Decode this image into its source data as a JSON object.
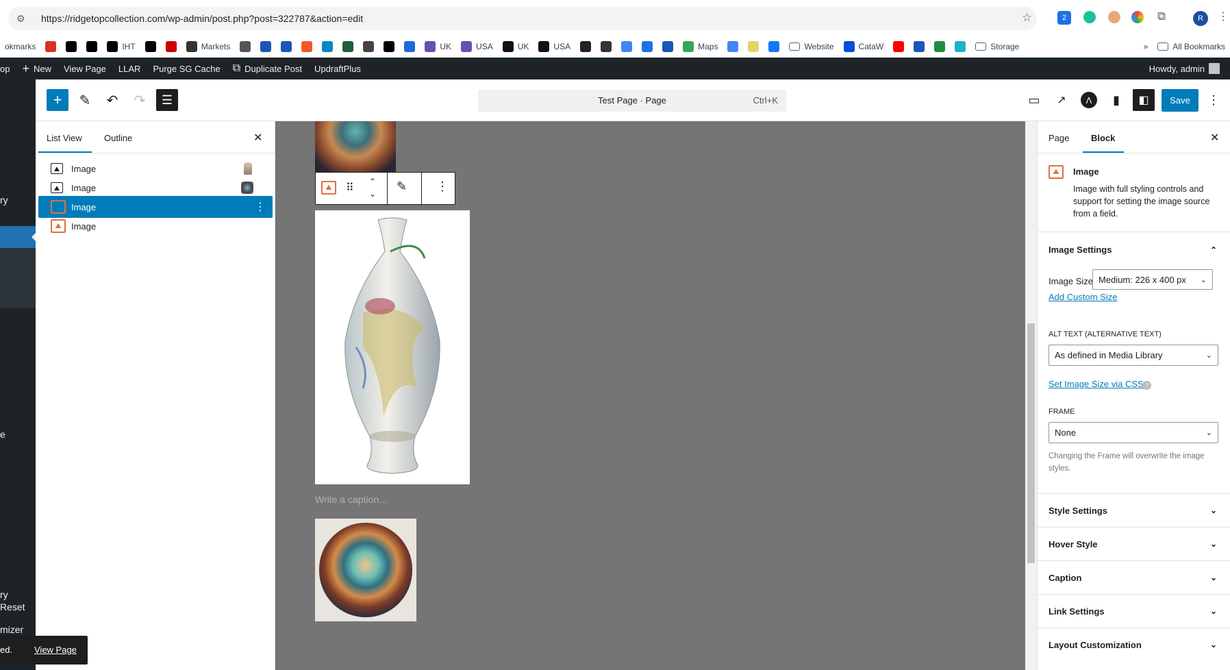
{
  "browser": {
    "url": "https://ridgetopcollection.com/wp-admin/post.php?post=322787&action=edit",
    "bookmarks": [
      {
        "label": "okmarks",
        "icon": "none"
      },
      {
        "label": "",
        "icon": "red-puzzle-icon"
      },
      {
        "label": "",
        "icon": "v-icon"
      },
      {
        "label": "",
        "icon": "t-icon"
      },
      {
        "label": "IHT",
        "icon": "nyt-icon"
      },
      {
        "label": "",
        "icon": "b-icon"
      },
      {
        "label": "",
        "icon": "cnn-icon"
      },
      {
        "label": "Markets",
        "icon": "markets-icon"
      },
      {
        "label": "",
        "icon": "globe-icon"
      },
      {
        "label": "",
        "icon": "b-blue-icon"
      },
      {
        "label": "",
        "icon": "shield-icon"
      },
      {
        "label": "",
        "icon": "orange-icon"
      },
      {
        "label": "",
        "icon": "arrow-icon"
      },
      {
        "label": "",
        "icon": "chart-icon"
      },
      {
        "label": "",
        "icon": "stripes-icon"
      },
      {
        "label": "",
        "icon": "b-circle-icon"
      },
      {
        "label": "",
        "icon": "sf-icon"
      },
      {
        "label": "UK",
        "icon": "bag-icon"
      },
      {
        "label": "USA",
        "icon": "bag-icon"
      },
      {
        "label": "UK",
        "icon": "amazon-icon"
      },
      {
        "label": "USA",
        "icon": "amazon-icon"
      },
      {
        "label": "",
        "icon": "w-question-icon"
      },
      {
        "label": "",
        "icon": "wikipedia-icon"
      },
      {
        "label": "",
        "icon": "google-icon"
      },
      {
        "label": "",
        "icon": "calendar-icon"
      },
      {
        "label": "",
        "icon": "person-icon"
      },
      {
        "label": "Maps",
        "icon": "maps-icon"
      },
      {
        "label": "",
        "icon": "translate-icon"
      },
      {
        "label": "",
        "icon": "note-icon"
      },
      {
        "label": "",
        "icon": "facebook-icon"
      },
      {
        "label": "Website",
        "icon": "folder-icon"
      },
      {
        "label": "CataW",
        "icon": "cataw-icon"
      },
      {
        "label": "",
        "icon": "youtube-icon"
      },
      {
        "label": "",
        "icon": "pound-icon"
      },
      {
        "label": "",
        "icon": "green-icon"
      },
      {
        "label": "",
        "icon": "cloud-icon"
      },
      {
        "label": "Storage",
        "icon": "folder-icon"
      }
    ],
    "more_bookmarks": "»",
    "all_bookmarks": "All Bookmarks"
  },
  "adminbar": {
    "items": [
      "op",
      "New",
      "View Page",
      "LLAR",
      "Purge SG Cache",
      "Duplicate Post",
      "UpdraftPlus"
    ],
    "howdy": "Howdy, admin"
  },
  "leftmenu": {
    "fragments": [
      "ry",
      "e",
      "ry",
      "Reset",
      "mizer",
      "ed."
    ]
  },
  "snackbar": {
    "link": "View Page"
  },
  "editor": {
    "title": "Test Page · Page",
    "shortcut": "Ctrl+K",
    "save": "Save"
  },
  "listview": {
    "tab_list": "List View",
    "tab_outline": "Outline",
    "items": [
      {
        "label": "Image",
        "selected": false
      },
      {
        "label": "Image",
        "selected": false
      },
      {
        "label": "Image",
        "selected": true
      },
      {
        "label": "Image",
        "selected": false
      }
    ]
  },
  "canvas": {
    "caption_placeholder": "Write a caption…"
  },
  "sidebar": {
    "tab_page": "Page",
    "tab_block": "Block",
    "block_name": "Image",
    "block_desc": "Image with full styling controls and support for setting the image source from a field.",
    "image_settings": "Image Settings",
    "image_size_label": "Image Size",
    "image_size_value": "Medium: 226 x 400 px",
    "add_custom_size": "Add Custom Size",
    "alt_text_label": "ALT TEXT (ALTERNATIVE TEXT)",
    "alt_text_value": "As defined in Media Library",
    "set_size_css": "Set Image Size via CSS",
    "frame_label": "FRAME",
    "frame_value": "None",
    "frame_help": "Changing the Frame will overwrite the image styles.",
    "panels": [
      "Style Settings",
      "Hover Style",
      "Caption",
      "Link Settings",
      "Layout Customization"
    ]
  },
  "colors": {
    "accent": "#007cba",
    "admin_bar": "#1d2327",
    "canvas": "#757575",
    "icon_orange": "#e26f3b"
  }
}
